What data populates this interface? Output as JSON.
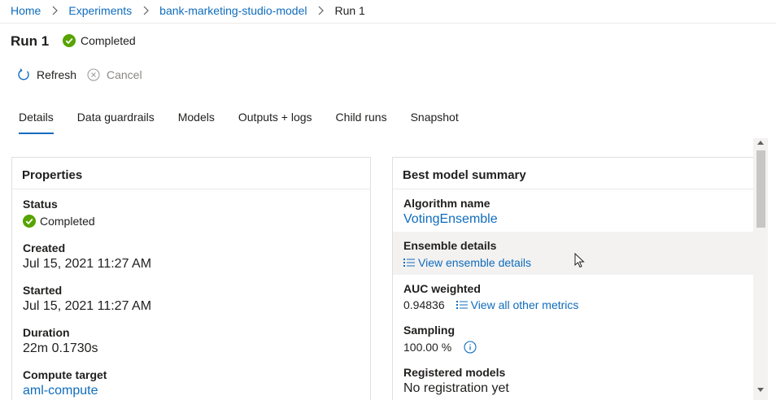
{
  "breadcrumb": {
    "items": [
      "Home",
      "Experiments",
      "bank-marketing-studio-model",
      "Run 1"
    ]
  },
  "header": {
    "title": "Run 1",
    "status": "Completed"
  },
  "toolbar": {
    "refresh_label": "Refresh",
    "cancel_label": "Cancel"
  },
  "tabs": [
    "Details",
    "Data guardrails",
    "Models",
    "Outputs + logs",
    "Child runs",
    "Snapshot"
  ],
  "properties": {
    "title": "Properties",
    "status_label": "Status",
    "status_value": "Completed",
    "created_label": "Created",
    "created_value": "Jul 15, 2021 11:27 AM",
    "started_label": "Started",
    "started_value": "Jul 15, 2021 11:27 AM",
    "duration_label": "Duration",
    "duration_value": "22m 0.1730s",
    "compute_label": "Compute target",
    "compute_value": "aml-compute"
  },
  "best_model": {
    "title": "Best model summary",
    "algorithm_label": "Algorithm name",
    "algorithm_value": "VotingEnsemble",
    "ensemble_label": "Ensemble details",
    "ensemble_link": "View ensemble details",
    "auc_label": "AUC weighted",
    "auc_value": "0.94836",
    "metrics_link": "View all other metrics",
    "sampling_label": "Sampling",
    "sampling_value": "100.00 %",
    "registered_label": "Registered models",
    "registered_value": "No registration yet"
  },
  "colors": {
    "accent": "#0f6cbd",
    "success": "#57a300",
    "muted": "#8a8886"
  }
}
